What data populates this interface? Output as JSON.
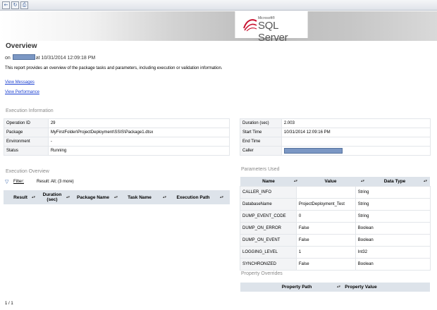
{
  "toolbar": {
    "buttons": [
      {
        "icon": "back-icon",
        "glyph": "←"
      },
      {
        "icon": "refresh-icon",
        "glyph": "↻"
      },
      {
        "icon": "print-icon",
        "glyph": "⎙"
      }
    ]
  },
  "logo": {
    "small_text": "Microsoft®",
    "main_text": "SQL Server"
  },
  "page": {
    "title": "Overview",
    "on_prefix": "on",
    "on_suffix": "at 10/31/2014 12:09:18 PM",
    "description": "This report provides an overview of the package tasks and parameters, including execution or validation information.",
    "link_messages": "View Messages",
    "link_performance": "View Performance"
  },
  "execution_info": {
    "heading": "Execution Information",
    "left_rows": [
      {
        "label": "Operation ID",
        "value": "29"
      },
      {
        "label": "Package",
        "value": "MyFirstFolder\\ProjectDeployment\\SSIS\\Package1.dtsx"
      },
      {
        "label": "Environment",
        "value": "-"
      },
      {
        "label": "Status",
        "value": "Running"
      }
    ],
    "right_rows": [
      {
        "label": "Duration (sec)",
        "value": "2.003"
      },
      {
        "label": "Start Time",
        "value": "10/31/2014 12:09:16 PM"
      },
      {
        "label": "End Time",
        "value": ""
      },
      {
        "label": "Caller",
        "value": ""
      }
    ]
  },
  "execution_overview": {
    "heading": "Execution Overview",
    "filter_label": "Filter:",
    "filter_result": "Result: All;  (3 more)",
    "columns": [
      "Result",
      "Duration (sec)",
      "Package Name",
      "Task Name",
      "Execution Path"
    ]
  },
  "parameters": {
    "heading": "Parameters Used",
    "columns": [
      "Name",
      "Value",
      "Data Type"
    ],
    "rows": [
      {
        "name": "CALLER_INFO",
        "value": "",
        "type": "String"
      },
      {
        "name": "DatabaseName",
        "value": "ProjectDeployment_Test",
        "type": "String"
      },
      {
        "name": "DUMP_EVENT_CODE",
        "value": "0",
        "type": "String"
      },
      {
        "name": "DUMP_ON_ERROR",
        "value": "False",
        "type": "Boolean"
      },
      {
        "name": "DUMP_ON_EVENT",
        "value": "False",
        "type": "Boolean"
      },
      {
        "name": "LOGGING_LEVEL",
        "value": "1",
        "type": "Int32"
      },
      {
        "name": "SYNCHRONIZED",
        "value": "False",
        "type": "Boolean"
      }
    ]
  },
  "property_overrides": {
    "heading": "Property Overrides",
    "columns": [
      "Property Path",
      "Property Value"
    ]
  },
  "pager": {
    "text": "1 / 1"
  },
  "colors": {
    "link": "#1a3fd1",
    "header_bg": "#dde3ea",
    "redaction": "#7b97c4",
    "section_heading": "#8a8a8a"
  }
}
